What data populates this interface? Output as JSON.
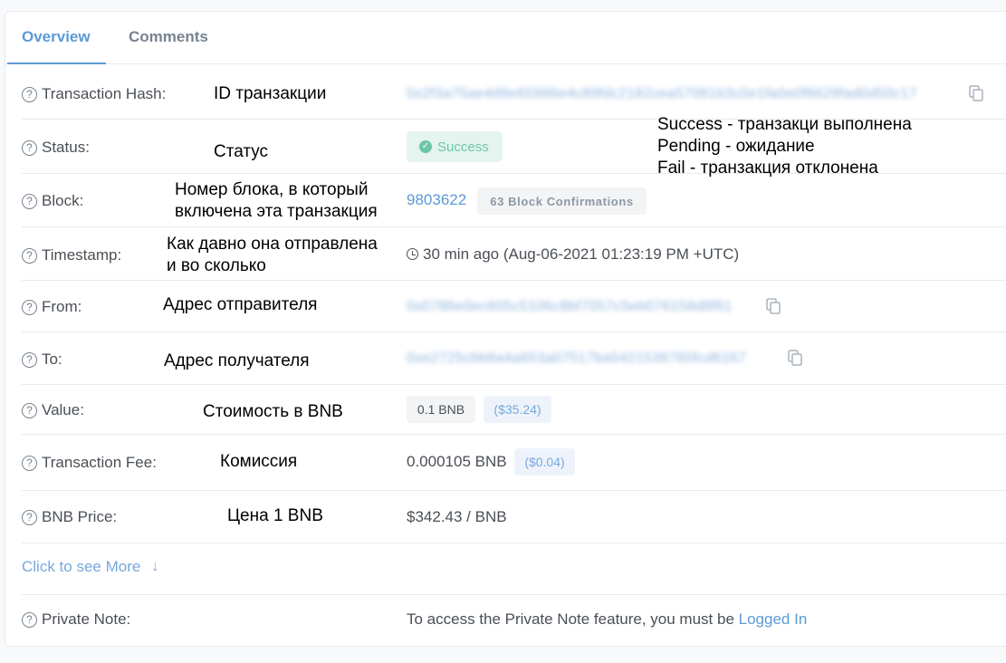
{
  "tabs": [
    {
      "label": "Overview",
      "active": true
    },
    {
      "label": "Comments",
      "active": false
    }
  ],
  "rows": {
    "hash": {
      "label": "Transaction Hash:",
      "annotation": "ID транзакции",
      "value": "0x2f3a75ae4d9e65966e4c89fdc2182cea57081b3c0e1fa0e0f6629fad0d50c17"
    },
    "status": {
      "label": "Status:",
      "annotation": "Статус",
      "value": "Success",
      "note_lines": [
        "Success - транзакци выполнена",
        "Pending - ожидание",
        "Fail - транзакция отклонена"
      ]
    },
    "block": {
      "label": "Block:",
      "annotation_lines": [
        "Номер блока, в который",
        "включена эта транзакция"
      ],
      "value": "9803622",
      "confirmations": "63 Block Confirmations"
    },
    "timestamp": {
      "label": "Timestamp:",
      "annotation_lines": [
        "Как давно она отправлена",
        "и во сколько"
      ],
      "value": "30 min ago (Aug-06-2021 01:23:19 PM +UTC)"
    },
    "from": {
      "label": "From:",
      "annotation": "Адрес отправителя",
      "value": "0x0786e0ec605c5106c8bf7057c5eb076158d8f61"
    },
    "to": {
      "label": "To:",
      "annotation": "Адрес получателя",
      "value": "0xe2725cbb8a4a653a07517ba5421536765fcd6167"
    },
    "value": {
      "label": "Value:",
      "annotation": "Стоимость в BNB",
      "amount": "0.1 BNB",
      "usd": "($35.24)"
    },
    "fee": {
      "label": "Transaction Fee:",
      "annotation": "Комиссия",
      "amount": "0.000105 BNB",
      "usd": "($0.04)"
    },
    "price": {
      "label": "BNB Price:",
      "annotation": "Цена 1 BNB",
      "value": "$342.43 / BNB"
    },
    "note": {
      "label": "Private Note:",
      "text": "To access the Private Note feature, you must be ",
      "link": "Logged In"
    }
  },
  "more": {
    "label": "Click to see More",
    "icon": "arrow-down-icon"
  },
  "icons": {
    "help": "?",
    "check": "✓",
    "arrow_down": "↓"
  },
  "colors": {
    "accent": "#5b9ad5",
    "success": "#6cc7a7",
    "border": "#e7eaf3"
  }
}
